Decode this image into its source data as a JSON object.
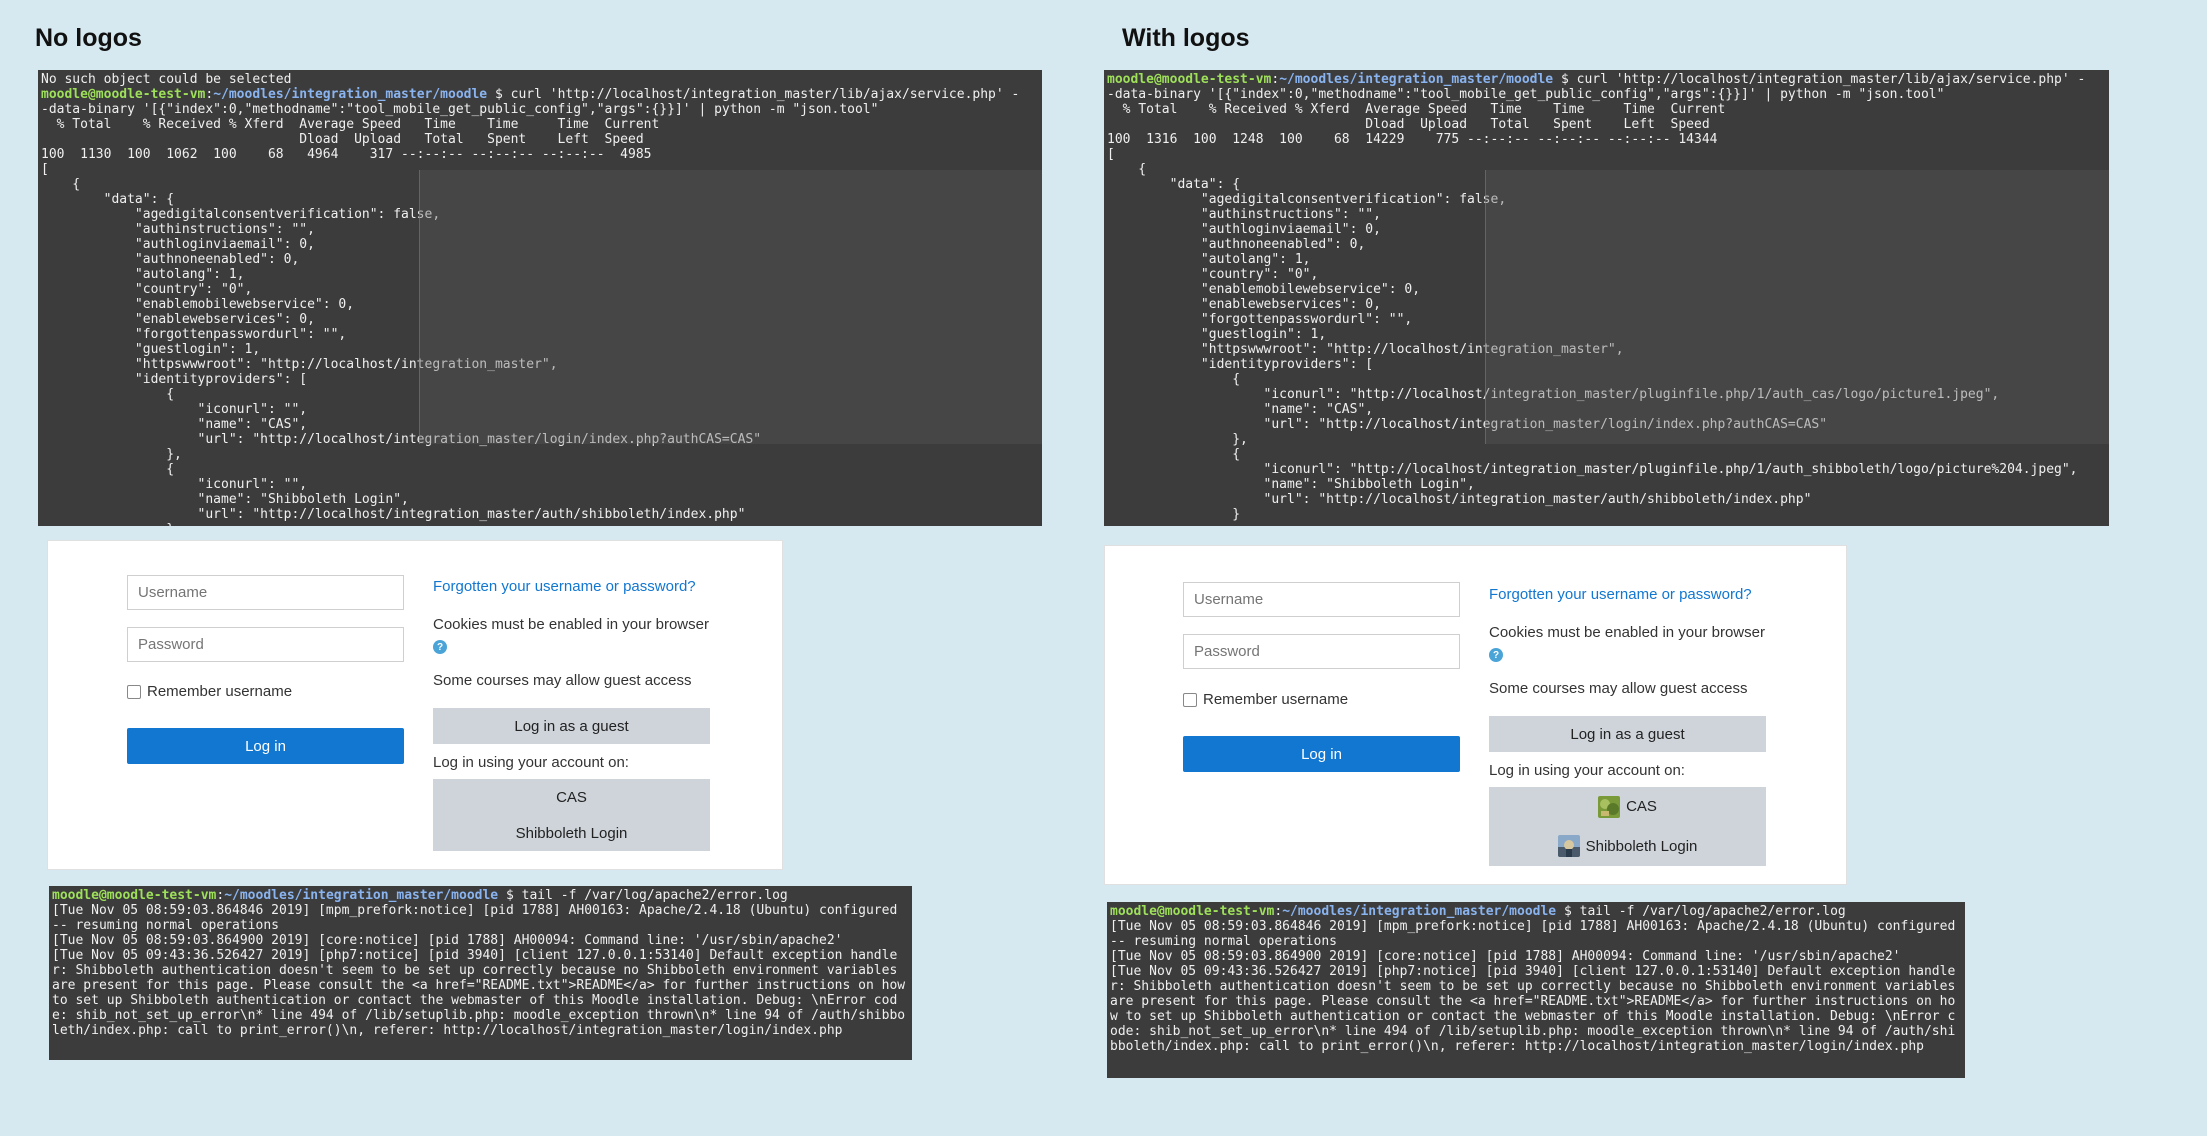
{
  "left": {
    "heading": "No logos",
    "curl_terminal": {
      "lines": [
        {
          "type": "text",
          "text": "No such object could be selected"
        },
        {
          "type": "prompt",
          "user": "moodle@moodle-test-vm",
          "path": "~/moodles/integration_master/moodle",
          "cmd": " $ curl 'http://localhost/integration_master/lib/ajax/service.php' -"
        },
        {
          "type": "text",
          "text": "-data-binary '[{\"index\":0,\"methodname\":\"tool_mobile_get_public_config\",\"args\":{}}]' | python -m \"json.tool\""
        },
        {
          "type": "text",
          "text": "  % Total    % Received % Xferd  Average Speed   Time    Time     Time  Current"
        },
        {
          "type": "text",
          "text": "                                 Dload  Upload   Total   Spent    Left  Speed"
        },
        {
          "type": "text",
          "text": "100  1130  100  1062  100    68   4964    317 --:--:-- --:--:-- --:--:--  4985"
        },
        {
          "type": "text",
          "text": "["
        },
        {
          "type": "text",
          "text": "    {"
        },
        {
          "type": "text",
          "text": "        \"data\": {"
        },
        {
          "type": "text",
          "text": "            \"agedigitalconsentverification\": false,"
        },
        {
          "type": "text",
          "text": "            \"authinstructions\": \"\","
        },
        {
          "type": "text",
          "text": "            \"authloginviaemail\": 0,"
        },
        {
          "type": "text",
          "text": "            \"authnoneenabled\": 0,"
        },
        {
          "type": "text",
          "text": "            \"autolang\": 1,"
        },
        {
          "type": "text",
          "text": "            \"country\": \"0\","
        },
        {
          "type": "text",
          "text": "            \"enablemobilewebservice\": 0,"
        },
        {
          "type": "text",
          "text": "            \"enablewebservices\": 0,"
        },
        {
          "type": "text",
          "text": "            \"forgottenpasswordurl\": \"\","
        },
        {
          "type": "text",
          "text": "            \"guestlogin\": 1,"
        },
        {
          "type": "text",
          "text": "            \"httpswwwroot\": \"http://localhost/integration_master\","
        },
        {
          "type": "text",
          "text": "            \"identityproviders\": ["
        },
        {
          "type": "text",
          "text": "                {"
        },
        {
          "type": "text",
          "text": "                    \"iconurl\": \"\","
        },
        {
          "type": "text",
          "text": "                    \"name\": \"CAS\","
        },
        {
          "type": "text",
          "text": "                    \"url\": \"http://localhost/integration_master/login/index.php?authCAS=CAS\""
        },
        {
          "type": "text",
          "text": "                },"
        },
        {
          "type": "text",
          "text": "                {"
        },
        {
          "type": "text",
          "text": "                    \"iconurl\": \"\","
        },
        {
          "type": "text",
          "text": "                    \"name\": \"Shibboleth Login\","
        },
        {
          "type": "text",
          "text": "                    \"url\": \"http://localhost/integration_master/auth/shibboleth/index.php\""
        },
        {
          "type": "text",
          "text": "                }"
        }
      ]
    },
    "login": {
      "username_placeholder": "Username",
      "password_placeholder": "Password",
      "remember_label": "Remember username",
      "login_button": "Log in",
      "forgot_link": "Forgotten your username or password?",
      "cookies_text": "Cookies must be enabled in your browser",
      "guest_text": "Some courses may allow guest access",
      "guest_button": "Log in as a guest",
      "account_text": "Log in using your account on:",
      "providers": [
        {
          "label": "CAS",
          "logo": "none"
        },
        {
          "label": "Shibboleth Login",
          "logo": "none"
        }
      ]
    },
    "log_terminal": {
      "prompt_user": "moodle@moodle-test-vm",
      "prompt_path": "~/moodles/integration_master/moodle",
      "prompt_cmd": " $ tail -f /var/log/apache2/error.log",
      "lines": [
        "[Tue Nov 05 08:59:03.864846 2019] [mpm_prefork:notice] [pid 1788] AH00163: Apache/2.4.18 (Ubuntu) configured -- resuming normal operations",
        "[Tue Nov 05 08:59:03.864900 2019] [core:notice] [pid 1788] AH00094: Command line: '/usr/sbin/apache2'",
        "[Tue Nov 05 09:43:36.526427 2019] [php7:notice] [pid 3940] [client 127.0.0.1:53140] Default exception handler: Shibboleth authentication doesn't seem to be set up correctly because no Shibboleth environment variables are present for this page. Please consult the <a href=\"README.txt\">README</a> for further instructions on how to set up Shibboleth authentication or contact the webmaster of this Moodle installation. Debug: \\nError code: shib_not_set_up_error\\n* line 494 of /lib/setuplib.php: moodle_exception thrown\\n* line 94 of /auth/shibboleth/index.php: call to print_error()\\n, referer: http://localhost/integration_master/login/index.php"
      ]
    }
  },
  "right": {
    "heading": "With logos",
    "curl_terminal": {
      "lines": [
        {
          "type": "prompt",
          "user": "moodle@moodle-test-vm",
          "path": "~/moodles/integration_master/moodle",
          "cmd": " $ curl 'http://localhost/integration_master/lib/ajax/service.php' -"
        },
        {
          "type": "text",
          "text": "-data-binary '[{\"index\":0,\"methodname\":\"tool_mobile_get_public_config\",\"args\":{}}]' | python -m \"json.tool\""
        },
        {
          "type": "text",
          "text": "  % Total    % Received % Xferd  Average Speed   Time    Time     Time  Current"
        },
        {
          "type": "text",
          "text": "                                 Dload  Upload   Total   Spent    Left  Speed"
        },
        {
          "type": "text",
          "text": "100  1316  100  1248  100    68  14229    775 --:--:-- --:--:-- --:--:-- 14344"
        },
        {
          "type": "text",
          "text": "["
        },
        {
          "type": "text",
          "text": "    {"
        },
        {
          "type": "text",
          "text": "        \"data\": {"
        },
        {
          "type": "text",
          "text": "            \"agedigitalconsentverification\": false,"
        },
        {
          "type": "text",
          "text": "            \"authinstructions\": \"\","
        },
        {
          "type": "text",
          "text": "            \"authloginviaemail\": 0,"
        },
        {
          "type": "text",
          "text": "            \"authnoneenabled\": 0,"
        },
        {
          "type": "text",
          "text": "            \"autolang\": 1,"
        },
        {
          "type": "text",
          "text": "            \"country\": \"0\","
        },
        {
          "type": "text",
          "text": "            \"enablemobilewebservice\": 0,"
        },
        {
          "type": "text",
          "text": "            \"enablewebservices\": 0,"
        },
        {
          "type": "text",
          "text": "            \"forgottenpasswordurl\": \"\","
        },
        {
          "type": "text",
          "text": "            \"guestlogin\": 1,"
        },
        {
          "type": "text",
          "text": "            \"httpswwwroot\": \"http://localhost/integration_master\","
        },
        {
          "type": "text",
          "text": "            \"identityproviders\": ["
        },
        {
          "type": "text",
          "text": "                {"
        },
        {
          "type": "text",
          "text": "                    \"iconurl\": \"http://localhost/integration_master/pluginfile.php/1/auth_cas/logo/picture1.jpeg\","
        },
        {
          "type": "text",
          "text": "                    \"name\": \"CAS\","
        },
        {
          "type": "text",
          "text": "                    \"url\": \"http://localhost/integration_master/login/index.php?authCAS=CAS\""
        },
        {
          "type": "text",
          "text": "                },"
        },
        {
          "type": "text",
          "text": "                {"
        },
        {
          "type": "text",
          "text": "                    \"iconurl\": \"http://localhost/integration_master/pluginfile.php/1/auth_shibboleth/logo/picture%204.jpeg\","
        },
        {
          "type": "text",
          "text": "                    \"name\": \"Shibboleth Login\","
        },
        {
          "type": "text",
          "text": "                    \"url\": \"http://localhost/integration_master/auth/shibboleth/index.php\""
        },
        {
          "type": "text",
          "text": "                }"
        }
      ]
    },
    "login": {
      "username_placeholder": "Username",
      "password_placeholder": "Password",
      "remember_label": "Remember username",
      "login_button": "Log in",
      "forgot_link": "Forgotten your username or password?",
      "cookies_text": "Cookies must be enabled in your browser",
      "guest_text": "Some courses may allow guest access",
      "guest_button": "Log in as a guest",
      "account_text": "Log in using your account on:",
      "providers": [
        {
          "label": "CAS",
          "logo": "cas-logo-image"
        },
        {
          "label": "Shibboleth Login",
          "logo": "shibboleth-logo-image"
        }
      ]
    },
    "log_terminal": {
      "prompt_user": "moodle@moodle-test-vm",
      "prompt_path": "~/moodles/integration_master/moodle",
      "prompt_cmd": " $ tail -f /var/log/apache2/error.log",
      "lines": [
        "[Tue Nov 05 08:59:03.864846 2019] [mpm_prefork:notice] [pid 1788] AH00163: Apache/2.4.18 (Ubuntu) configured -- resuming normal operations",
        "[Tue Nov 05 08:59:03.864900 2019] [core:notice] [pid 1788] AH00094: Command line: '/usr/sbin/apache2'",
        "[Tue Nov 05 09:43:36.526427 2019] [php7:notice] [pid 3940] [client 127.0.0.1:53140] Default exception handler: Shibboleth authentication doesn't seem to be set up correctly because no Shibboleth environment variables are present for this page. Please consult the <a href=\"README.txt\">README</a> for further instructions on how to set up Shibboleth authentication or contact the webmaster of this Moodle installation. Debug: \\nError code: shib_not_set_up_error\\n* line 494 of /lib/setuplib.php: moodle_exception thrown\\n* line 94 of /auth/shibboleth/index.php: call to print_error()\\n, referer: http://localhost/integration_master/login/index.php"
      ]
    }
  },
  "colors": {
    "background": "#d6e9f1",
    "terminal_bg": "#3c3c3c",
    "prompt_user": "#9ee05a",
    "prompt_path": "#8ab4f0",
    "primary_button": "#1177d1",
    "secondary_button": "#ced4da",
    "link": "#1177d1"
  }
}
